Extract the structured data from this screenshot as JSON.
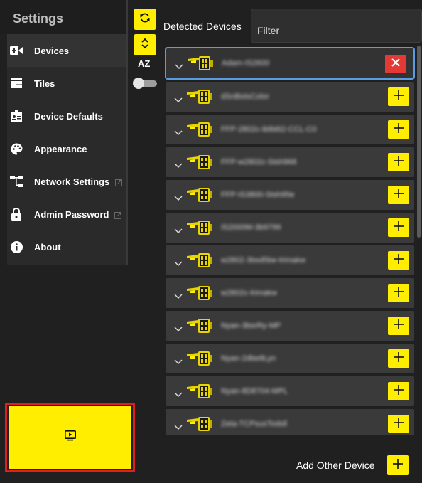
{
  "sidebar": {
    "title": "Settings",
    "items": [
      {
        "label": "Devices",
        "icon": "video-camera-icon",
        "active": true,
        "external": false
      },
      {
        "label": "Tiles",
        "icon": "tiles-icon",
        "active": false,
        "external": false
      },
      {
        "label": "Device Defaults",
        "icon": "badge-icon",
        "active": false,
        "external": false
      },
      {
        "label": "Appearance",
        "icon": "palette-icon",
        "active": false,
        "external": false
      },
      {
        "label": "Network Settings",
        "icon": "network-icon",
        "active": false,
        "external": true
      },
      {
        "label": "Admin Password",
        "icon": "lock-icon",
        "active": false,
        "external": true
      },
      {
        "label": "About",
        "icon": "info-icon",
        "active": false,
        "external": false
      }
    ],
    "preview_button_icon": "preview-screen-icon"
  },
  "toolbar": {
    "refresh_icon": "refresh-icon",
    "expand_icon": "expand-collapse-icon",
    "sort_label": "AZ",
    "sort_toggle_on": false
  },
  "header": {
    "title": "Detected Devices",
    "filter_placeholder": "Filter"
  },
  "devices": [
    {
      "name": "Adam-IS2600",
      "selected": true,
      "action": "remove"
    },
    {
      "name": "dSnBotsColor",
      "selected": false,
      "action": "add"
    },
    {
      "name": "FFP-2802c-tblbt62-CCL-C0",
      "selected": false,
      "action": "add"
    },
    {
      "name": "FFP-w2802c-Stsh968",
      "selected": false,
      "action": "add"
    },
    {
      "name": "FFP-IS3800-Stsh95e",
      "selected": false,
      "action": "add"
    },
    {
      "name": "IS2000M-3b9799",
      "selected": false,
      "action": "add"
    },
    {
      "name": "w2802-3bsd5be-lrimakw",
      "selected": false,
      "action": "add"
    },
    {
      "name": "w2802c-lrimakw",
      "selected": false,
      "action": "add"
    },
    {
      "name": "Nyan-3bsrRy-MP",
      "selected": false,
      "action": "add"
    },
    {
      "name": "Nyan-2dbe8Lyn",
      "selected": false,
      "action": "add"
    },
    {
      "name": "Nyan-8D8704-MPL",
      "selected": false,
      "action": "add"
    },
    {
      "name": "Zeta-TCPsusTodsll",
      "selected": false,
      "action": "add"
    }
  ],
  "footer": {
    "add_other_label": "Add Other Device"
  },
  "colors": {
    "accent": "#ffee00",
    "remove": "#e53935",
    "selected_border": "#5b9ce0",
    "highlight_frame": "#e21d1d"
  }
}
